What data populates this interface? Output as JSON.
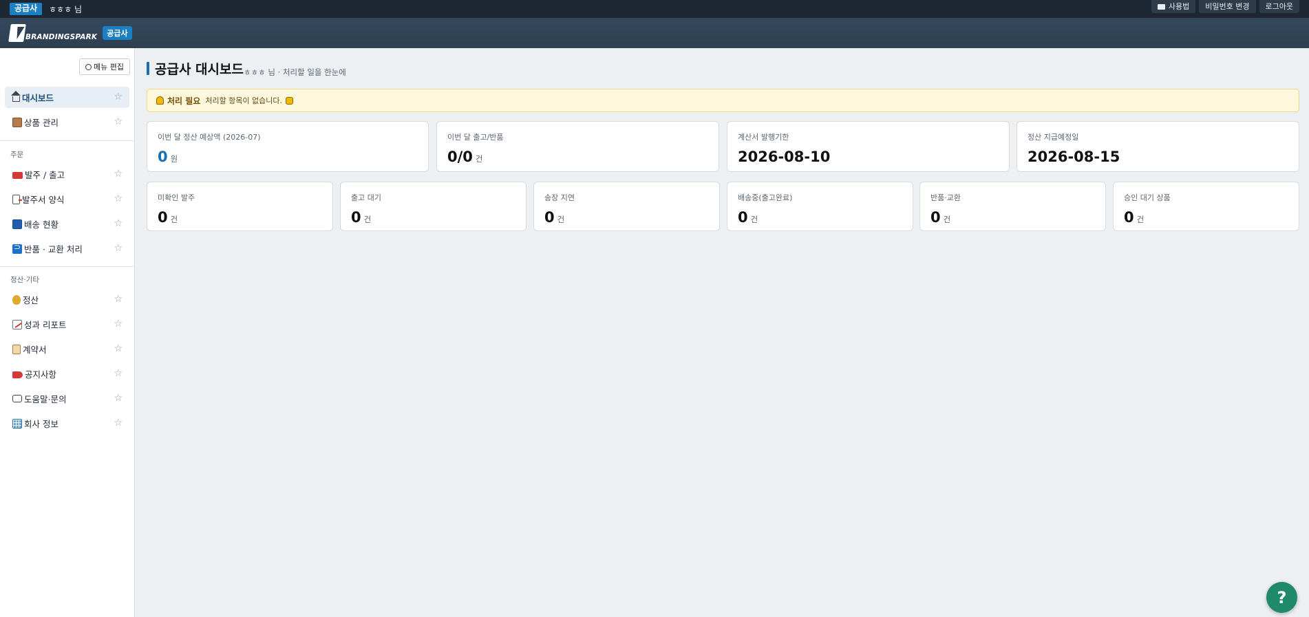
{
  "topbar": {
    "role_badge": "공급사",
    "user": "ㅎㅎㅎ 님",
    "actions": [
      {
        "label": "사용법",
        "icon": "book-icon"
      },
      {
        "label": "비밀번호 변경"
      },
      {
        "label": "로그아웃"
      }
    ]
  },
  "header": {
    "logo_text": "BRANDINGSPARK",
    "badge": "공급사"
  },
  "sidebar": {
    "menu_edit_label": "메뉴 편집",
    "sections": [
      {
        "label": "",
        "items": [
          {
            "label": "대시보드",
            "icon": "home-icon",
            "active": true
          },
          {
            "label": "상품 관리",
            "icon": "box-icon"
          }
        ]
      },
      {
        "label": "주문",
        "items": [
          {
            "label": "발주 / 출고",
            "icon": "truck-icon"
          },
          {
            "label": "발주서 양식",
            "icon": "document-icon"
          },
          {
            "label": "배송 현황",
            "icon": "book-icon"
          },
          {
            "label": "반품 · 교환 처리",
            "icon": "return-icon"
          }
        ]
      },
      {
        "label": "정산·기타",
        "items": [
          {
            "label": "정산",
            "icon": "money-bag-icon"
          },
          {
            "label": "성과 리포트",
            "icon": "chart-icon"
          },
          {
            "label": "계약서",
            "icon": "scroll-icon"
          },
          {
            "label": "공지사항",
            "icon": "megaphone-icon"
          },
          {
            "label": "도움말·문의",
            "icon": "chat-icon"
          },
          {
            "label": "회사 정보",
            "icon": "building-icon"
          }
        ]
      }
    ],
    "star_glyph": "☆"
  },
  "main": {
    "title": "공급사 대시보드",
    "subtitle": "ㅎㅎㅎ 님 · 처리할 일을 한눈에",
    "alert": {
      "title": "처리 필요",
      "text": "처리할 항목이 없습니다."
    },
    "summary_cards": [
      {
        "label": "이번 달 정산 예상액 (2026-07)",
        "value": "0",
        "unit": "원",
        "highlight": true
      },
      {
        "label": "이번 달 출고/반품",
        "value": "0/0",
        "unit": "건"
      },
      {
        "label": "계산서 발행기한",
        "value": "2026-08-10",
        "unit": ""
      },
      {
        "label": "정산 지급예정일",
        "value": "2026-08-15",
        "unit": ""
      }
    ],
    "status_cards": [
      {
        "label": "미확인 발주",
        "value": "0",
        "unit": "건"
      },
      {
        "label": "출고 대기",
        "value": "0",
        "unit": "건"
      },
      {
        "label": "송장 지연",
        "value": "0",
        "unit": "건"
      },
      {
        "label": "배송중(출고완료)",
        "value": "0",
        "unit": "건"
      },
      {
        "label": "반품·교환",
        "value": "0",
        "unit": "건"
      },
      {
        "label": "승인 대기 상품",
        "value": "0",
        "unit": "건"
      }
    ],
    "help_button": "?"
  },
  "colors": {
    "accent": "#1b7fc1",
    "topbar": "#1c2733",
    "header": "#2d3f51",
    "help": "#1e8a6a"
  }
}
